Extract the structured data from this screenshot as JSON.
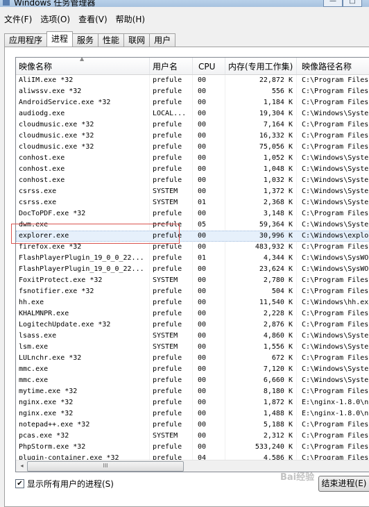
{
  "window": {
    "title": "Windows 任务管理器",
    "buttons": [
      "—",
      "□"
    ]
  },
  "menu": [
    "文件(F)",
    "选项(O)",
    "查看(V)",
    "帮助(H)"
  ],
  "tabs": [
    {
      "label": "应用程序",
      "active": false
    },
    {
      "label": "进程",
      "active": true
    },
    {
      "label": "服务",
      "active": false
    },
    {
      "label": "性能",
      "active": false
    },
    {
      "label": "联网",
      "active": false
    },
    {
      "label": "用户",
      "active": false
    }
  ],
  "columns": {
    "name": "映像名称",
    "user": "用户名",
    "cpu": "CPU",
    "mem": "内存(专用工作集)",
    "path": "映像路径名称"
  },
  "sort_indicator": "▲",
  "selected_row": 14,
  "processes": [
    {
      "name": "AliIM.exe *32",
      "user": "prefule",
      "cpu": "00",
      "mem": "22,872 K",
      "path": "C:\\Program Files"
    },
    {
      "name": "aliwssv.exe *32",
      "user": "prefule",
      "cpu": "00",
      "mem": "556 K",
      "path": "C:\\Program Files"
    },
    {
      "name": "AndroidService.exe *32",
      "user": "prefule",
      "cpu": "00",
      "mem": "1,184 K",
      "path": "C:\\Program Files"
    },
    {
      "name": "audiodg.exe",
      "user": "LOCAL...",
      "cpu": "00",
      "mem": "19,304 K",
      "path": "C:\\Windows\\Syste"
    },
    {
      "name": "cloudmusic.exe *32",
      "user": "prefule",
      "cpu": "00",
      "mem": "7,164 K",
      "path": "C:\\Program Files"
    },
    {
      "name": "cloudmusic.exe *32",
      "user": "prefule",
      "cpu": "00",
      "mem": "16,332 K",
      "path": "C:\\Program Files"
    },
    {
      "name": "cloudmusic.exe *32",
      "user": "prefule",
      "cpu": "00",
      "mem": "75,056 K",
      "path": "C:\\Program Files"
    },
    {
      "name": "conhost.exe",
      "user": "prefule",
      "cpu": "00",
      "mem": "1,052 K",
      "path": "C:\\Windows\\Syste"
    },
    {
      "name": "conhost.exe",
      "user": "prefule",
      "cpu": "00",
      "mem": "1,048 K",
      "path": "C:\\Windows\\Syste"
    },
    {
      "name": "conhost.exe",
      "user": "prefule",
      "cpu": "00",
      "mem": "1,032 K",
      "path": "C:\\Windows\\Syste"
    },
    {
      "name": "csrss.exe",
      "user": "SYSTEM",
      "cpu": "00",
      "mem": "1,372 K",
      "path": "C:\\Windows\\Syste"
    },
    {
      "name": "csrss.exe",
      "user": "SYSTEM",
      "cpu": "01",
      "mem": "2,368 K",
      "path": "C:\\Windows\\Syste"
    },
    {
      "name": "DocToPDF.exe *32",
      "user": "prefule",
      "cpu": "00",
      "mem": "3,148 K",
      "path": "C:\\Program Files"
    },
    {
      "name": "dwm.exe",
      "user": "prefule",
      "cpu": "05",
      "mem": "59,364 K",
      "path": "C:\\Windows\\Syste"
    },
    {
      "name": "explorer.exe",
      "user": "prefule",
      "cpu": "00",
      "mem": "30,996 K",
      "path": "C:\\Windows\\explo"
    },
    {
      "name": "firefox.exe *32",
      "user": "prefule",
      "cpu": "00",
      "mem": "483,932 K",
      "path": "C:\\Program Files"
    },
    {
      "name": "FlashPlayerPlugin_19_0_0_22...",
      "user": "prefule",
      "cpu": "01",
      "mem": "4,344 K",
      "path": "C:\\Windows\\SysWO"
    },
    {
      "name": "FlashPlayerPlugin_19_0_0_22...",
      "user": "prefule",
      "cpu": "00",
      "mem": "23,624 K",
      "path": "C:\\Windows\\SysWO"
    },
    {
      "name": "FoxitProtect.exe *32",
      "user": "SYSTEM",
      "cpu": "00",
      "mem": "2,780 K",
      "path": "C:\\Program Files"
    },
    {
      "name": "fsnotifier.exe *32",
      "user": "prefule",
      "cpu": "00",
      "mem": "504 K",
      "path": "C:\\Program Files"
    },
    {
      "name": "hh.exe",
      "user": "prefule",
      "cpu": "00",
      "mem": "11,540 K",
      "path": "C:\\Windows\\hh.exe"
    },
    {
      "name": "KHALMNPR.exe",
      "user": "prefule",
      "cpu": "00",
      "mem": "2,228 K",
      "path": "C:\\Program Files"
    },
    {
      "name": "LogitechUpdate.exe *32",
      "user": "prefule",
      "cpu": "00",
      "mem": "2,876 K",
      "path": "C:\\Program Files"
    },
    {
      "name": "lsass.exe",
      "user": "SYSTEM",
      "cpu": "00",
      "mem": "4,860 K",
      "path": "C:\\Windows\\Syste"
    },
    {
      "name": "lsm.exe",
      "user": "SYSTEM",
      "cpu": "00",
      "mem": "1,556 K",
      "path": "C:\\Windows\\Syste"
    },
    {
      "name": "LULnchr.exe *32",
      "user": "prefule",
      "cpu": "00",
      "mem": "672 K",
      "path": "C:\\Program Files"
    },
    {
      "name": "mmc.exe",
      "user": "prefule",
      "cpu": "00",
      "mem": "7,120 K",
      "path": "C:\\Windows\\Syste"
    },
    {
      "name": "mmc.exe",
      "user": "prefule",
      "cpu": "00",
      "mem": "6,660 K",
      "path": "C:\\Windows\\Syste"
    },
    {
      "name": "mytime.exe *32",
      "user": "prefule",
      "cpu": "00",
      "mem": "8,180 K",
      "path": "C:\\Program Files"
    },
    {
      "name": "nginx.exe *32",
      "user": "prefule",
      "cpu": "00",
      "mem": "1,872 K",
      "path": "E:\\nginx-1.8.0\\n"
    },
    {
      "name": "nginx.exe *32",
      "user": "prefule",
      "cpu": "00",
      "mem": "1,488 K",
      "path": "E:\\nginx-1.8.0\\n"
    },
    {
      "name": "notepad++.exe *32",
      "user": "prefule",
      "cpu": "00",
      "mem": "5,188 K",
      "path": "C:\\Program Files"
    },
    {
      "name": "pcas.exe *32",
      "user": "SYSTEM",
      "cpu": "00",
      "mem": "2,312 K",
      "path": "C:\\Program Files"
    },
    {
      "name": "PhpStorm.exe *32",
      "user": "prefule",
      "cpu": "00",
      "mem": "533,240 K",
      "path": "C:\\Program Files"
    },
    {
      "name": "plugin-container.exe *32",
      "user": "prefule",
      "cpu": "04",
      "mem": "4,586 K",
      "path": "C:\\Program Files"
    }
  ],
  "scroll": {
    "left": "◂",
    "thumb": "III"
  },
  "footer": {
    "checkbox_mark": "✔",
    "show_all_label": "显示所有用户的进程(S)",
    "end_button": "结束进程(E)"
  },
  "watermark": "Bai经验"
}
